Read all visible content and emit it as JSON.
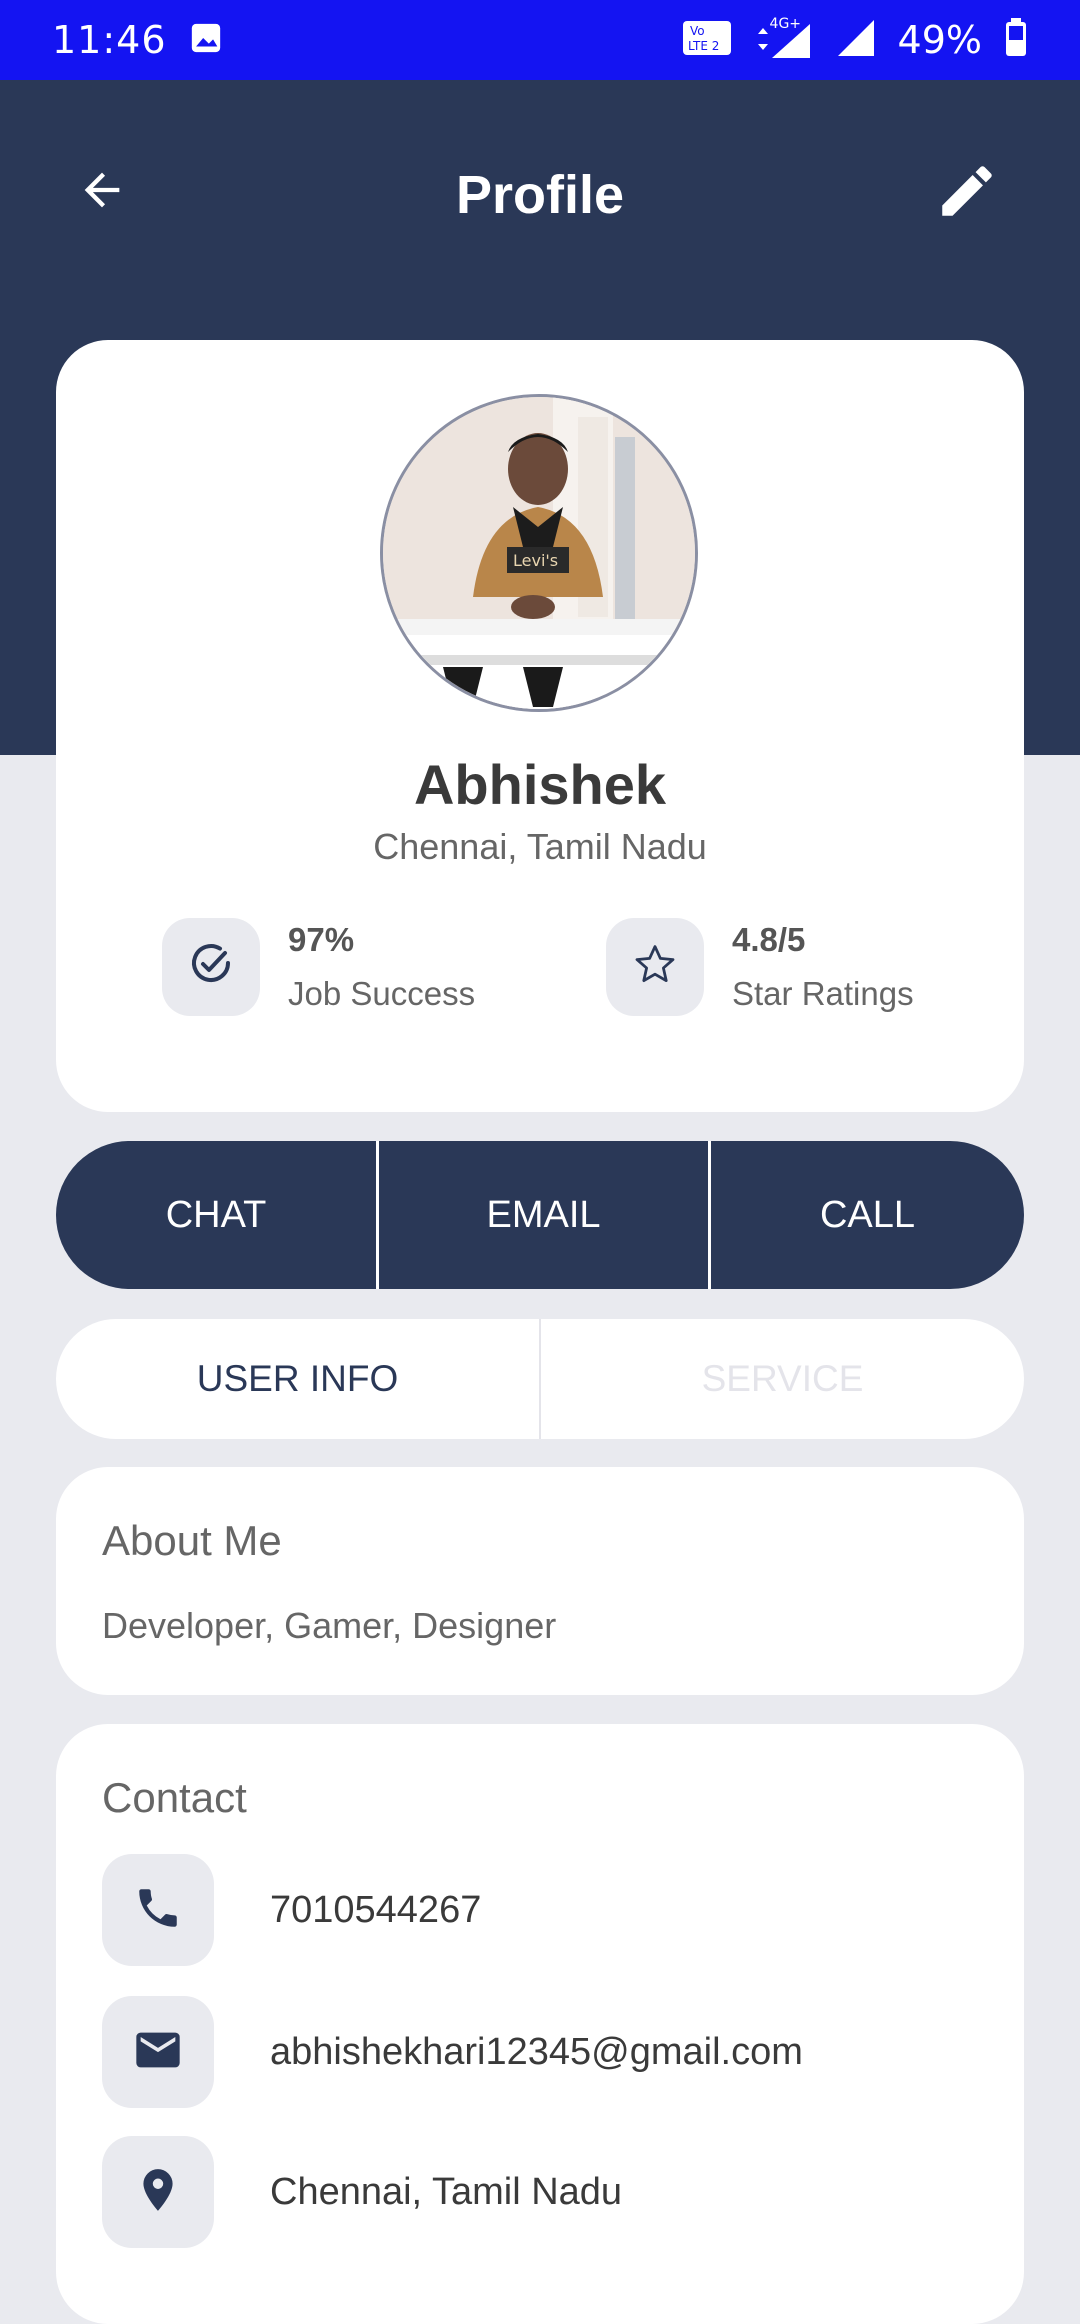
{
  "status_bar": {
    "time": "11:46",
    "battery_percent": "49%",
    "network_label": "4G+",
    "icons": [
      "image-icon",
      "volte-icon",
      "signal-4g-icon",
      "signal-icon",
      "battery-icon"
    ]
  },
  "header": {
    "title": "Profile",
    "back_icon": "arrow-left-icon",
    "edit_icon": "pencil-icon",
    "background_color": "#2A3857"
  },
  "profile": {
    "name": "Abhishek",
    "location": "Chennai, Tamil Nadu",
    "avatar_hoodie_text": "Levi's",
    "stats": [
      {
        "icon": "check-circle-icon",
        "value": "97%",
        "label": "Job Success"
      },
      {
        "icon": "star-icon",
        "value": "4.8/5",
        "label": "Star Ratings"
      }
    ]
  },
  "actions": [
    "CHAT",
    "EMAIL",
    "CALL"
  ],
  "tabs": [
    {
      "label": "USER INFO",
      "active": true
    },
    {
      "label": "SERVICE",
      "active": false
    }
  ],
  "about": {
    "title": "About Me",
    "text": "Developer, Gamer, Designer"
  },
  "contact": {
    "title": "Contact",
    "items": [
      {
        "icon": "phone-icon",
        "text": "7010544267"
      },
      {
        "icon": "email-icon",
        "text": "abhishekhari12345@gmail.com"
      },
      {
        "icon": "location-pin-icon",
        "text": "Chennai, Tamil Nadu"
      }
    ]
  },
  "colors": {
    "status_bar": "#1414F2",
    "primary": "#2A3857",
    "page_background": "#E9EAEF"
  }
}
